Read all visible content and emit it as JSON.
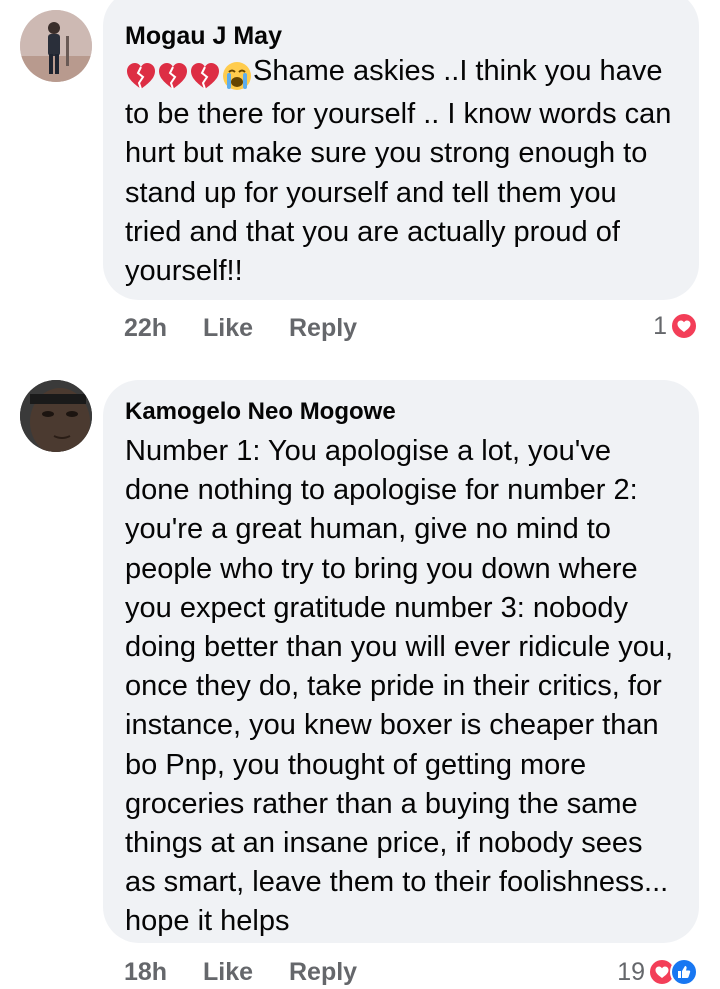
{
  "comments": [
    {
      "author": "Mogau J May",
      "emojis": [
        "broken-heart",
        "broken-heart",
        "broken-heart",
        "loudly-crying-face"
      ],
      "text": "Shame askies ..I think you have to be there for yourself .. I know words can hurt but make sure you strong enough to stand up for yourself and tell them you tried and that you are actually proud of yourself!!",
      "time": "22h",
      "like_label": "Like",
      "reply_label": "Reply",
      "reaction_count": "1",
      "reaction_icons": [
        "love-reaction-icon"
      ]
    },
    {
      "author": "Kamogelo Neo Mogowe",
      "text": "Number 1: You apologise a lot, you've done nothing to apologise for number 2: you're a great human, give no mind to people who try to bring you down where you expect gratitude number 3: nobody doing better than you will ever ridicule you, once they do, take pride in their critics, for instance, you knew boxer is cheaper than bo Pnp, you thought of getting more groceries rather than a buying the same things at an insane price, if nobody sees as smart, leave them to their foolishness... hope it helps",
      "time": "18h",
      "like_label": "Like",
      "reply_label": "Reply",
      "reaction_count": "19",
      "reaction_icons": [
        "love-reaction-icon",
        "like-reaction-icon"
      ]
    }
  ],
  "colors": {
    "bubble": "#f0f2f5",
    "meta_text": "#65676b",
    "love": "#f33e58",
    "like": "#1877f2"
  }
}
